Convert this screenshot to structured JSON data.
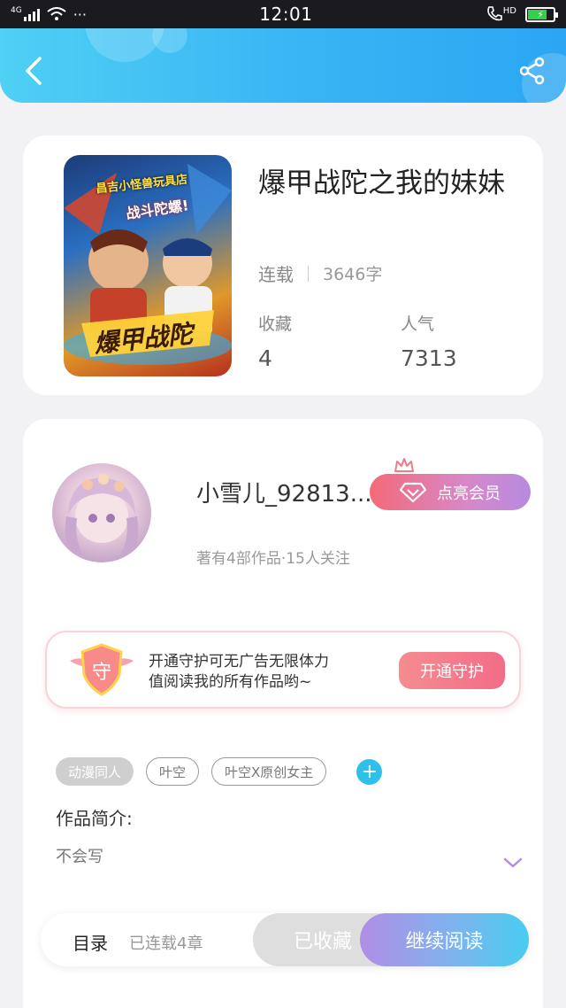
{
  "status_bar": {
    "network": "4G",
    "more": "···",
    "time": "12:01",
    "hd": "HD",
    "battery_level": 0.7
  },
  "header": {
    "back_icon": "chevron-left-icon",
    "share_icon": "share-icon"
  },
  "book": {
    "cover_text_top": "昌吉小怪兽玩具店",
    "cover_text_mid": "战斗陀螺!",
    "cover_text_bottom": "爆甲战陀",
    "title": "爆甲战陀之我的妹妹",
    "status": "连载",
    "word_count": "3646字",
    "stats": [
      {
        "label": "收藏",
        "value": "4"
      },
      {
        "label": "人气",
        "value": "7313"
      }
    ]
  },
  "author": {
    "name": "小雪儿_92813...",
    "meta": "著有4部作品·15人关注",
    "vip_button": "点亮会员",
    "vip_icon": "diamond-icon"
  },
  "guard": {
    "badge_char": "守",
    "text_line1": "开通守护可无广告无限体力",
    "text_line2": "值阅读我的所有作品哟~",
    "button": "开通守护"
  },
  "tags": [
    "动漫同人",
    "叶空",
    "叶空X原创女主"
  ],
  "tag_add": "+",
  "intro": {
    "label": "作品简介:",
    "text": "不会写"
  },
  "bottom_bar": {
    "toc": "目录",
    "chapters": "已连载4章",
    "collected": "已收藏",
    "continue_reading": "继续阅读"
  },
  "colors": {
    "header_gradient": [
      "#4fd0f4",
      "#2ba6f3"
    ],
    "vip_gradient": [
      "#f36a78",
      "#b78ae0"
    ],
    "guard_button": "#f36c88",
    "tag_add": "#2ec0ea",
    "read_gradient": [
      "#b08ee6",
      "#48cdf0"
    ]
  }
}
